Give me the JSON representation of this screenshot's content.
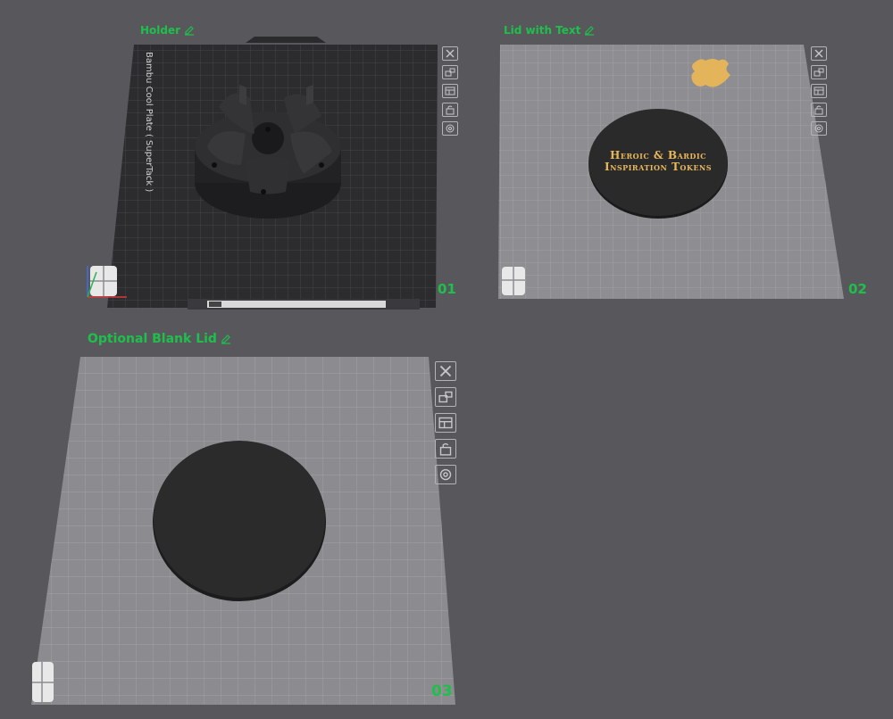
{
  "plates": [
    {
      "title": "Holder",
      "number": "01",
      "bed_label": "Bambu Cool Plate ( SuperTack )",
      "toolbar": [
        "close-icon",
        "arrange-icon",
        "layout-icon",
        "lock-icon",
        "settings-icon"
      ]
    },
    {
      "title": "Lid with Text",
      "number": "02",
      "lid_text_line1": "Heroic & Bardic",
      "lid_text_line2": "Inspiration Tokens",
      "toolbar": [
        "close-icon",
        "arrange-icon",
        "layout-icon",
        "lock-icon",
        "settings-icon"
      ]
    },
    {
      "title": "Optional Blank Lid",
      "number": "03",
      "toolbar": [
        "close-icon",
        "arrange-icon",
        "layout-icon",
        "lock-icon",
        "settings-icon"
      ]
    }
  ],
  "colors": {
    "background": "#58585c",
    "accent": "#1fbf4b",
    "dark_plate": "#2c2c2f",
    "light_plate": "#8e8e92",
    "part": "#2a2a2a",
    "text_gold": "#e9b85a"
  }
}
